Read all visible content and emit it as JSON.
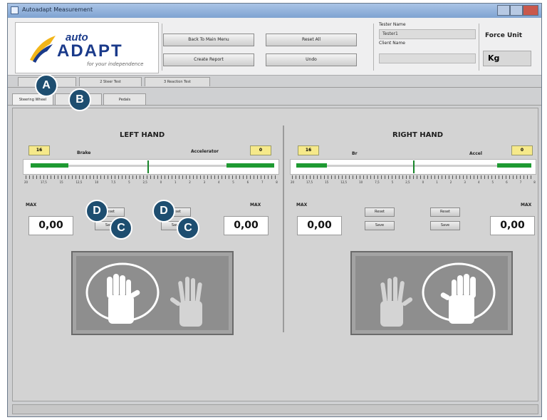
{
  "window": {
    "title": "Autoadapt Measurement"
  },
  "logo": {
    "word1": "auto",
    "word2": "ADAPT",
    "tagline": "for your independence"
  },
  "header": {
    "buttons": {
      "back_menu": "Back To Main Menu",
      "reset_all": "Reset All",
      "create_report": "Create Report",
      "undo": "Undo"
    },
    "tester_name_label": "Tester Name",
    "tester_name_value": "Tester1",
    "client_name_label": "Client Name",
    "client_name_value": "",
    "force_unit_label": "Force Unit",
    "force_unit_value": "Kg"
  },
  "tabs_top": [
    "1 Hand",
    "2 Steer Test",
    "3 Reaction Test"
  ],
  "tabs_sub": [
    "Steering Wheel",
    "Brake",
    "Pedals"
  ],
  "left": {
    "title": "LEFT HAND",
    "brake_value": "16",
    "accel_value": "0",
    "brake_label": "Brake",
    "accel_label": "Accelerator",
    "brake_fill": 0.22,
    "accel_fill": 0.28,
    "max_label_left": "MAX",
    "max_label_right": "MAX",
    "max_left": "0,00",
    "max_right": "0,00"
  },
  "right": {
    "title": "RIGHT HAND",
    "brake_value": "16",
    "accel_value": "0",
    "brake_label": "Br",
    "accel_label": "Accel",
    "brake_fill": 0.18,
    "accel_fill": 0.2,
    "max_label_left": "MAX",
    "max_label_right": "MAX",
    "max_left": "0,00",
    "max_right": "0,00",
    "reset_label": "Reset",
    "save_label": "Save"
  },
  "scale": [
    "20",
    "17,5",
    "15",
    "12,5",
    "10",
    "7,5",
    "5",
    "2,5",
    "0",
    "1",
    "2",
    "3",
    "4",
    "5",
    "6",
    "7",
    "8"
  ],
  "callouts": {
    "a": "A",
    "b": "B",
    "c": "C",
    "d": "D"
  },
  "colors": {
    "green": "#1e9a32",
    "callout": "#1e4e70",
    "highlight": "#f6e98a"
  }
}
